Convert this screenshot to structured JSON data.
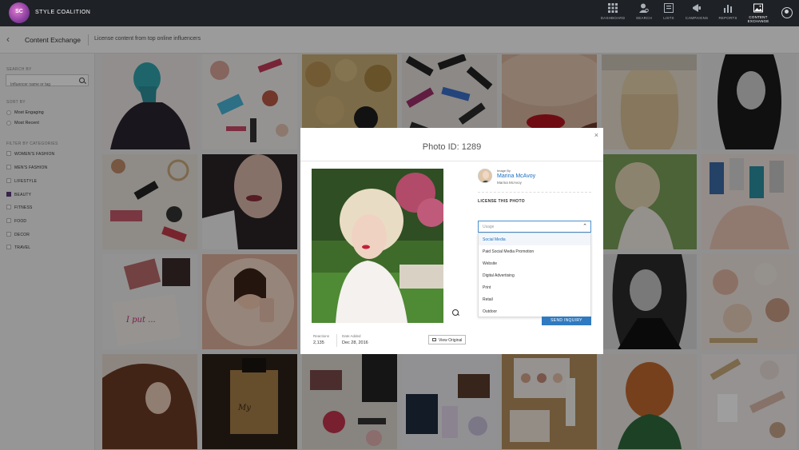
{
  "nav": {
    "brand": "STYLE COALITION",
    "logo_text": "SC",
    "items": [
      {
        "label": "DASHBOARD",
        "icon": "grid-icon"
      },
      {
        "label": "SEARCH",
        "icon": "person-search-icon"
      },
      {
        "label": "LISTS",
        "icon": "list-icon"
      },
      {
        "label": "CAMPAIGNS",
        "icon": "megaphone-icon"
      },
      {
        "label": "REPORTS",
        "icon": "bar-chart-icon"
      },
      {
        "label": "CONTENT",
        "label2": "EXCHANGE",
        "icon": "image-icon",
        "active": true
      }
    ]
  },
  "subheader": {
    "title": "Content Exchange",
    "description": "License content from top online influencers"
  },
  "sidebar": {
    "search_heading": "SEARCH BY",
    "search_placeholder": "Influencer name or tag",
    "sort_heading": "SORT BY",
    "sort_options": [
      "Most Engaging",
      "Most Recent"
    ],
    "filter_heading": "FILTER BY CATEGORIES",
    "categories": [
      {
        "label": "WOMEN'S FASHION",
        "checked": false
      },
      {
        "label": "MEN'S FASHION",
        "checked": false
      },
      {
        "label": "LIFESTYLE",
        "checked": false
      },
      {
        "label": "BEAUTY",
        "checked": true
      },
      {
        "label": "FITNESS",
        "checked": false
      },
      {
        "label": "FOOD",
        "checked": false
      },
      {
        "label": "DECOR",
        "checked": false
      },
      {
        "label": "TRAVEL",
        "checked": false
      }
    ]
  },
  "modal": {
    "title": "Photo ID: 1289",
    "close": "×",
    "image_by_label": "Image By",
    "influencer_name": "Marina McAvoy",
    "influencer_handle": "Marina McAvoy",
    "license_title": "LICENSE THIS PHOTO",
    "usage_placeholder": "Usage",
    "usage_options": [
      "Social Media",
      "Paid Social Media Promotion",
      "Website",
      "Digital Advertising",
      "Print",
      "Retail",
      "Outdoor"
    ],
    "reactions_label": "Reactions",
    "reactions_value": "2,135",
    "date_label": "Date Added",
    "date_value": "Dec 28, 2016",
    "view_original": "View Original",
    "send_inquiry": "SEND INQUIRY"
  },
  "colors": {
    "nav_bg": "#1e2126",
    "accent_blue": "#2f7ac0",
    "link_blue": "#1a6fc0",
    "checkbox_purple": "#5a3d7a"
  },
  "grid": {
    "tiles": [
      {
        "name": "tile-teal-braid",
        "bg": "#3a7f8a"
      },
      {
        "name": "tile-makeup-flatlay",
        "bg": "#e9e4df"
      },
      {
        "name": "tile-gold-roses",
        "bg": "#b59a62"
      },
      {
        "name": "tile-lipsticks",
        "bg": "#d8d2cc"
      },
      {
        "name": "tile-red-lips",
        "bg": "#c9a38a"
      },
      {
        "name": "tile-blonde-waves",
        "bg": "#d9c8ae"
      },
      {
        "name": "tile-bw-portrait",
        "bg": "#3a3a3a"
      },
      {
        "name": "tile-jewelry",
        "bg": "#ddd4cc"
      },
      {
        "name": "tile-lip-liner",
        "bg": "#2b2b2b"
      },
      {
        "name": "tile-blonde-braid",
        "bg": "#b8b0a4"
      },
      {
        "name": "tile-nail-polish",
        "bg": "#ecdcd7"
      },
      {
        "name": "tile-palette-pouch",
        "bg": "#e2dede"
      },
      {
        "name": "tile-rose-gold-phone",
        "bg": "#d9aa98"
      },
      {
        "name": "tile-bw-choker",
        "bg": "#bdbdbd"
      },
      {
        "name": "tile-blush-compacts",
        "bg": "#e6d8ce"
      },
      {
        "name": "tile-brunette-hair",
        "bg": "#7a4a3a"
      },
      {
        "name": "tile-perfume",
        "bg": "#4a3a2a"
      },
      {
        "name": "tile-cosmetics-book",
        "bg": "#d6d0c8"
      },
      {
        "name": "tile-makeup-bag",
        "bg": "#e4e4e8"
      },
      {
        "name": "tile-eyeshadow-wood",
        "bg": "#c7a57a"
      },
      {
        "name": "tile-copper-braid",
        "bg": "#b66a3a"
      },
      {
        "name": "tile-skincare-flatlay",
        "bg": "#ede6e2"
      }
    ]
  }
}
